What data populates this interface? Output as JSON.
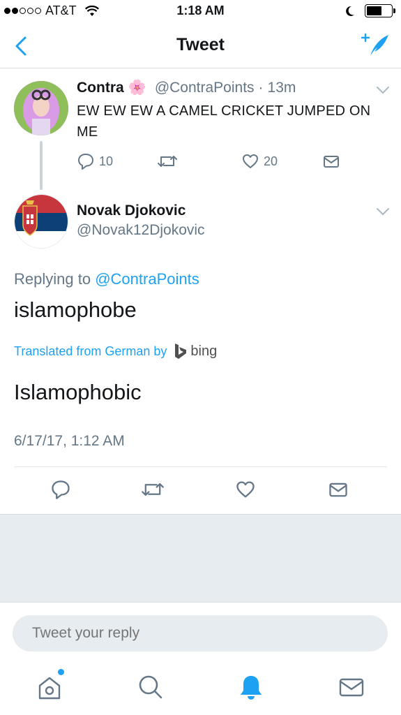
{
  "status_bar": {
    "carrier": "AT&T",
    "time": "1:18 AM"
  },
  "nav": {
    "title": "Tweet"
  },
  "parent_tweet": {
    "name": "Contra",
    "emoji": "🌸",
    "handle": "@ContraPoints",
    "separator": "·",
    "age": "13m",
    "text": "EW EW EW A CAMEL CRICKET JUMPED ON ME",
    "reply_count": "10",
    "like_count": "20"
  },
  "main_tweet": {
    "name": "Novak Djokovic",
    "handle": "@Novak12Djokovic",
    "replying_prefix": "Replying to",
    "replying_to": "@ContraPoints",
    "text": "islamophobe",
    "translated_label": "Translated from German by",
    "translator": "bing",
    "translation": "Islamophobic",
    "timestamp": "6/17/17, 1:12 AM"
  },
  "reply_bar": {
    "placeholder": "Tweet your reply"
  },
  "colors": {
    "accent": "#1da1f2",
    "secondary_text": "#657786",
    "divider": "#e1e8ed",
    "gray_area": "#e6ecf0"
  },
  "icons": {
    "back": "chevron-left-icon",
    "compose": "compose-tweet-icon",
    "reply": "reply-icon",
    "retweet": "retweet-icon",
    "like": "heart-icon",
    "dm": "envelope-icon",
    "home": "home-icon",
    "search": "search-icon",
    "notifications": "bell-icon",
    "messages": "envelope-icon"
  }
}
